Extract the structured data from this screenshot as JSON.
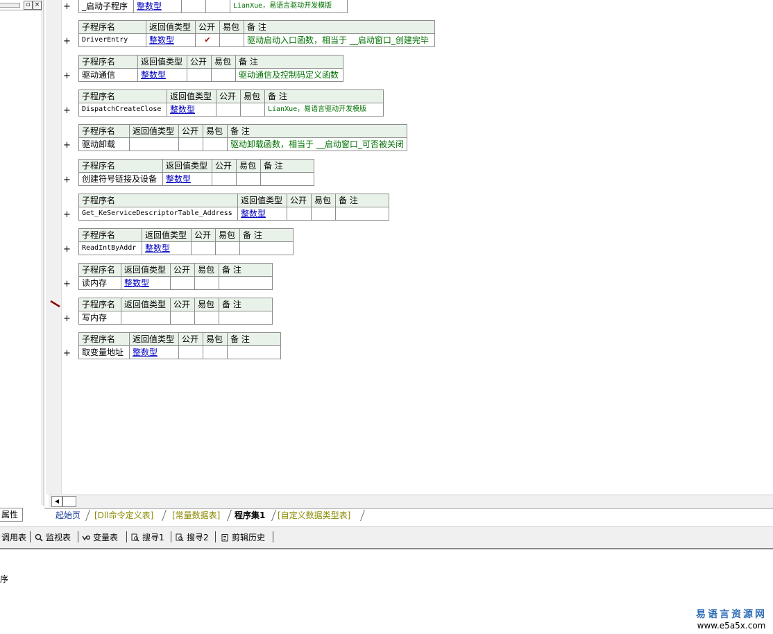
{
  "left_panel": {
    "restore_glyph": "▫",
    "close_glyph": "×",
    "properties_tab": "属性"
  },
  "editor": {
    "header_labels": {
      "name": "子程序名",
      "return_type": "返回值类型",
      "public": "公开",
      "easy_package": "易包",
      "remark": "备 注"
    },
    "expand_glyph": "+",
    "check_glyph": "✔",
    "first_row": {
      "name": "_启动子程序",
      "return_type": "整数型",
      "remark": "LianXue，易语言驱动开发模版"
    },
    "subroutines": [
      {
        "name": "DriverEntry",
        "return_type": "整数型",
        "public": "✔",
        "remark": "驱动启动入口函数，相当于 __启动窗口_创建完毕"
      },
      {
        "name": "驱动通信",
        "return_type": "整数型",
        "public": "",
        "remark": "驱动通信及控制码定义函数"
      },
      {
        "name": "DispatchCreateClose",
        "return_type": "整数型",
        "public": "",
        "remark": "LianXue，易语言驱动开发模版"
      },
      {
        "name": "驱动卸载",
        "return_type": "",
        "public": "",
        "remark": "驱动卸载函数，相当于 __启动窗口_可否被关闭"
      },
      {
        "name": "创建符号链接及设备",
        "return_type": "整数型",
        "public": "",
        "remark": ""
      },
      {
        "name": "Get_KeServiceDescriptorTable_Address",
        "return_type": "整数型",
        "public": "",
        "remark": ""
      },
      {
        "name": "ReadIntByAddr",
        "return_type": "整数型",
        "public": "",
        "remark": ""
      },
      {
        "name": "读内存",
        "return_type": "整数型",
        "public": "",
        "remark": ""
      },
      {
        "name": "写内存",
        "return_type": "",
        "public": "",
        "remark": ""
      },
      {
        "name": "取变量地址",
        "return_type": "整数型",
        "public": "",
        "remark": ""
      }
    ]
  },
  "doc_tabs": [
    {
      "label": "起始页"
    },
    {
      "label": "[Dll命令定义表]"
    },
    {
      "label": "[常量数据表]"
    },
    {
      "label": "程序集1"
    },
    {
      "label": "[自定义数据类型表]"
    }
  ],
  "bottom_toolbar": {
    "items": [
      {
        "label": "调用表",
        "icon": "call-table-icon"
      },
      {
        "label": "监视表",
        "icon": "magnifier-icon"
      },
      {
        "label": "变量表",
        "icon": "variables-icon"
      },
      {
        "label": "搜寻1",
        "icon": "search-doc-icon"
      },
      {
        "label": "搜寻2",
        "icon": "search-doc-icon"
      },
      {
        "label": "剪辑历史",
        "icon": "clipboard-icon"
      }
    ]
  },
  "output": {
    "text": "序"
  },
  "watermark": {
    "title": "易语言资源网",
    "url": "www.e5a5x.com"
  },
  "colors": {
    "header_bg": "#e9f2e9",
    "type_link": "#0000c0",
    "remark_text": "#007000",
    "check_mark": "#a00000",
    "active_tab_fg": "#000000",
    "inactive_tab_fg": "#8a8a00",
    "start_tab_fg": "#1b3c9a",
    "watermark_fg": "#2f6db6"
  }
}
